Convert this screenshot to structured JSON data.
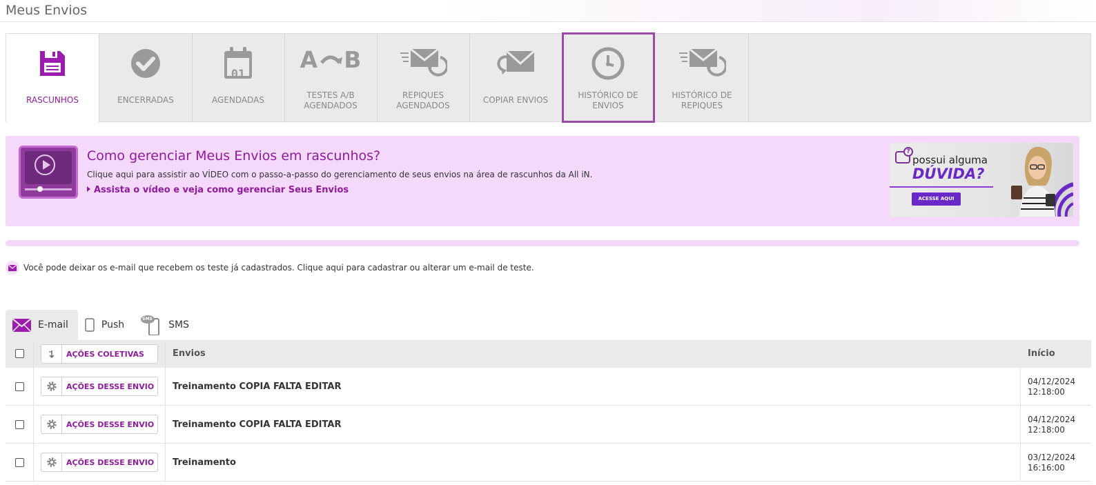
{
  "header": {
    "title": "Meus Envios"
  },
  "tabs": [
    {
      "label": "RASCUNHOS",
      "icon": "floppy-disk-icon",
      "active": true
    },
    {
      "label": "ENCERRADAS",
      "icon": "check-circle-icon"
    },
    {
      "label": "AGENDADAS",
      "icon": "calendar-icon",
      "calendar_day": "01"
    },
    {
      "label_line1": "TESTES A/B",
      "label_line2": "AGENDADOS",
      "icon": "ab-test-icon",
      "icon_a": "A",
      "icon_b": "B"
    },
    {
      "label_line1": "REPIQUES",
      "label_line2": "AGENDADOS",
      "icon": "repique-envelope-icon"
    },
    {
      "label": "COPIAR ENVIOS",
      "icon": "copy-envelope-icon"
    },
    {
      "label_line1": "HISTÓRICO DE",
      "label_line2": "ENVIOS",
      "icon": "clock-icon",
      "highlighted": true
    },
    {
      "label_line1": "HISTÓRICO DE",
      "label_line2": "REPIQUES",
      "icon": "repique-envelope-icon"
    }
  ],
  "video_banner": {
    "title": "Como gerenciar Meus Envios em rascunhos?",
    "description": "Clique aqui para assistir ao VÍDEO com o passo-a-passo do gerenciamento de seus envios na área de rascunhos da All iN.",
    "link_text": "Assista o vídeo e veja como gerenciar Seus Envios",
    "help_ad": {
      "line1": "possui alguma",
      "line2": "DÚVIDA?",
      "cta": "ACESSE AQUI"
    }
  },
  "test_notice": {
    "text": "Você pode deixar os e-mail que recebem os teste já cadastrados. Clique aqui para cadastrar ou alterar um e-mail de teste."
  },
  "channel_tabs": [
    {
      "label": "E-mail",
      "icon": "envelope-icon",
      "active": true
    },
    {
      "label": "Push",
      "icon": "mobile-icon"
    },
    {
      "label": "SMS",
      "icon": "sms-phone-icon",
      "icon_text": "SMS"
    }
  ],
  "table": {
    "bulk_actions_label": "AÇÕES COLETIVAS",
    "columns": {
      "envios": "Envios",
      "inicio": "Início"
    },
    "row_action_label": "AÇÕES DESSE ENVIO",
    "rows": [
      {
        "name": "Treinamento COPIA FALTA EDITAR",
        "date": "04/12/2024",
        "time": "12:18:00"
      },
      {
        "name": "Treinamento COPIA FALTA EDITAR",
        "date": "04/12/2024",
        "time": "12:18:00"
      },
      {
        "name": "Treinamento",
        "date": "03/12/2024",
        "time": "16:16:00"
      }
    ]
  },
  "colors": {
    "accent": "#8e1c9c",
    "banner_bg": "#f4d9fb",
    "tab_bg": "#eaeaea",
    "highlight_border": "#9b4aa8",
    "ad_accent": "#6a28c7"
  }
}
